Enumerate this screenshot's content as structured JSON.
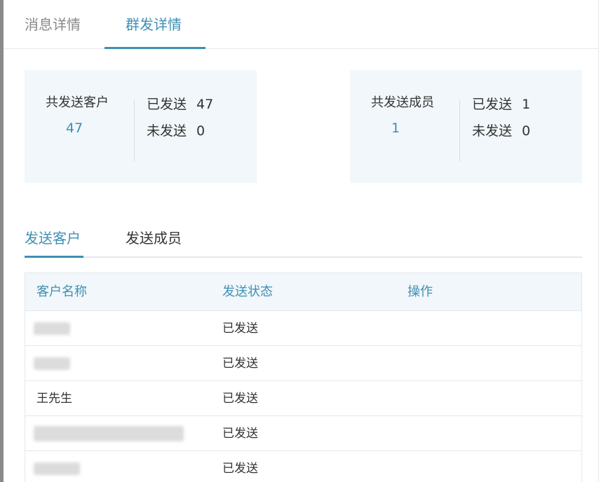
{
  "tabs": [
    {
      "label": "消息详情"
    },
    {
      "label": "群发详情"
    }
  ],
  "summary_customers": {
    "title": "共发送客户",
    "total": "47",
    "sent_label": "已发送",
    "sent_value": "47",
    "unsent_label": "未发送",
    "unsent_value": "0"
  },
  "summary_members": {
    "title": "共发送成员",
    "total": "1",
    "sent_label": "已发送",
    "sent_value": "1",
    "unsent_label": "未发送",
    "unsent_value": "0"
  },
  "sub_tabs": [
    {
      "label": "发送客户"
    },
    {
      "label": "发送成员"
    }
  ],
  "table": {
    "headers": [
      "客户名称",
      "发送状态",
      "操作"
    ],
    "rows": [
      {
        "name": "",
        "status": "已发送"
      },
      {
        "name": "",
        "status": "已发送"
      },
      {
        "name": "王先生",
        "status": "已发送"
      },
      {
        "name": "",
        "status": "已发送"
      },
      {
        "name": "",
        "status": "已发送"
      }
    ]
  },
  "colors": {
    "accent": "#3f8fb5",
    "panel_bg": "#f1f7fa",
    "border": "#e4e7ed"
  }
}
